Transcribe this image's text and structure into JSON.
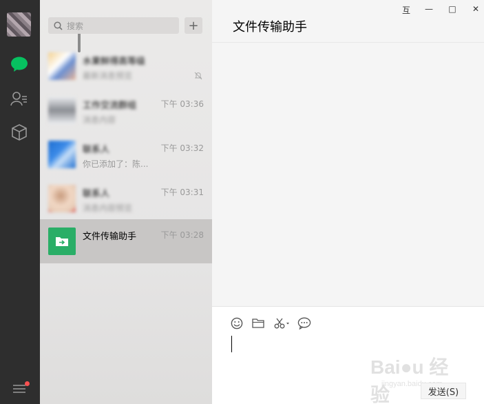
{
  "window": {
    "pin": "互",
    "minimize": "—",
    "maximize": "□",
    "close": "✕"
  },
  "nav": {
    "items": [
      "chat-icon",
      "contacts-icon",
      "favorites-icon"
    ],
    "menu_icon": "menu-icon",
    "chat_active_color": "#07c160"
  },
  "search": {
    "placeholder": "搜索"
  },
  "add_button": "+",
  "chats": [
    {
      "name": "水果鲜得高等级",
      "time": "",
      "preview": "最新消息预览",
      "muted": true,
      "blurred": true
    },
    {
      "name": "工作交流群组",
      "time": "下午 03:36",
      "preview": "消息内容",
      "muted": false,
      "blurred": true
    },
    {
      "name": "联系人",
      "time": "下午 03:32",
      "preview": "你已添加了：陈...",
      "muted": false,
      "blurred": true
    },
    {
      "name": "联系人",
      "time": "下午 03:31",
      "preview": "消息内容预览",
      "muted": false,
      "blurred": true
    },
    {
      "name": "文件传输助手",
      "time": "下午 03:28",
      "preview": "",
      "muted": false,
      "blurred": false
    }
  ],
  "conversation": {
    "title": "文件传输助手"
  },
  "toolbar": [
    "emoji-icon",
    "folder-icon",
    "scissors-icon",
    "chat-bubble-icon"
  ],
  "send_label": "发送(S)",
  "watermark": {
    "text": "Bai●u 经验",
    "sub": "jingyan.baidu.com"
  },
  "colors": {
    "accent": "#07c160",
    "nav_bg": "#2e2e2e",
    "badge": "#fa5151"
  }
}
